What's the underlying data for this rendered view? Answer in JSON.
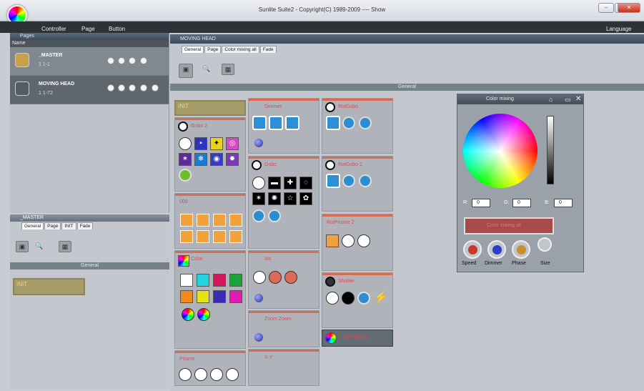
{
  "window": {
    "title": "Sunlite Suite2 - Copyright(C) 1989-2009 ---- Show"
  },
  "menubar": {
    "items": [
      "Controller",
      "Page",
      "Button"
    ],
    "language": "Language"
  },
  "pages_panel": {
    "title": "Pages",
    "col_name": "Name",
    "rows": [
      {
        "name": "_MASTER",
        "sub": "1  1-1"
      },
      {
        "name": "MOVING HEAD",
        "sub": "1  1-72"
      }
    ]
  },
  "master_panel": {
    "title": "_MASTER",
    "tabs": [
      "General",
      "Page",
      "INIT",
      "Fade"
    ],
    "section": "General",
    "init": "INIT"
  },
  "main": {
    "title": "MOVING HEAD",
    "tabs": [
      "General",
      "Page",
      "Color mixing all",
      "Fade"
    ],
    "section": "General",
    "cells": {
      "init": "INIT",
      "gobo2": "Gobo 2",
      "dimmer": "Dimmer",
      "rotgobo": "RotGobo",
      "gobo": "Gobo",
      "rotgobo2": "RotGobo 2",
      "ooo": "000",
      "rotprisme2": "RotPrisme 2",
      "color": "Color",
      "iris": "Iris",
      "shutter": "Shutter",
      "zoom": "Zoom Zoom",
      "colormixing": "Color mixing",
      "prisme": "Prisme",
      "xy": "X-Y"
    }
  },
  "color_mixing": {
    "title": "Color mixing",
    "r_label": "R:",
    "g_label": "G:",
    "b_label": "B:",
    "r": "0",
    "g": "0",
    "b": "0",
    "all_label": "Color mixing all",
    "knobs": [
      "Speed",
      "Dimmer",
      "Phase",
      "Size"
    ]
  }
}
